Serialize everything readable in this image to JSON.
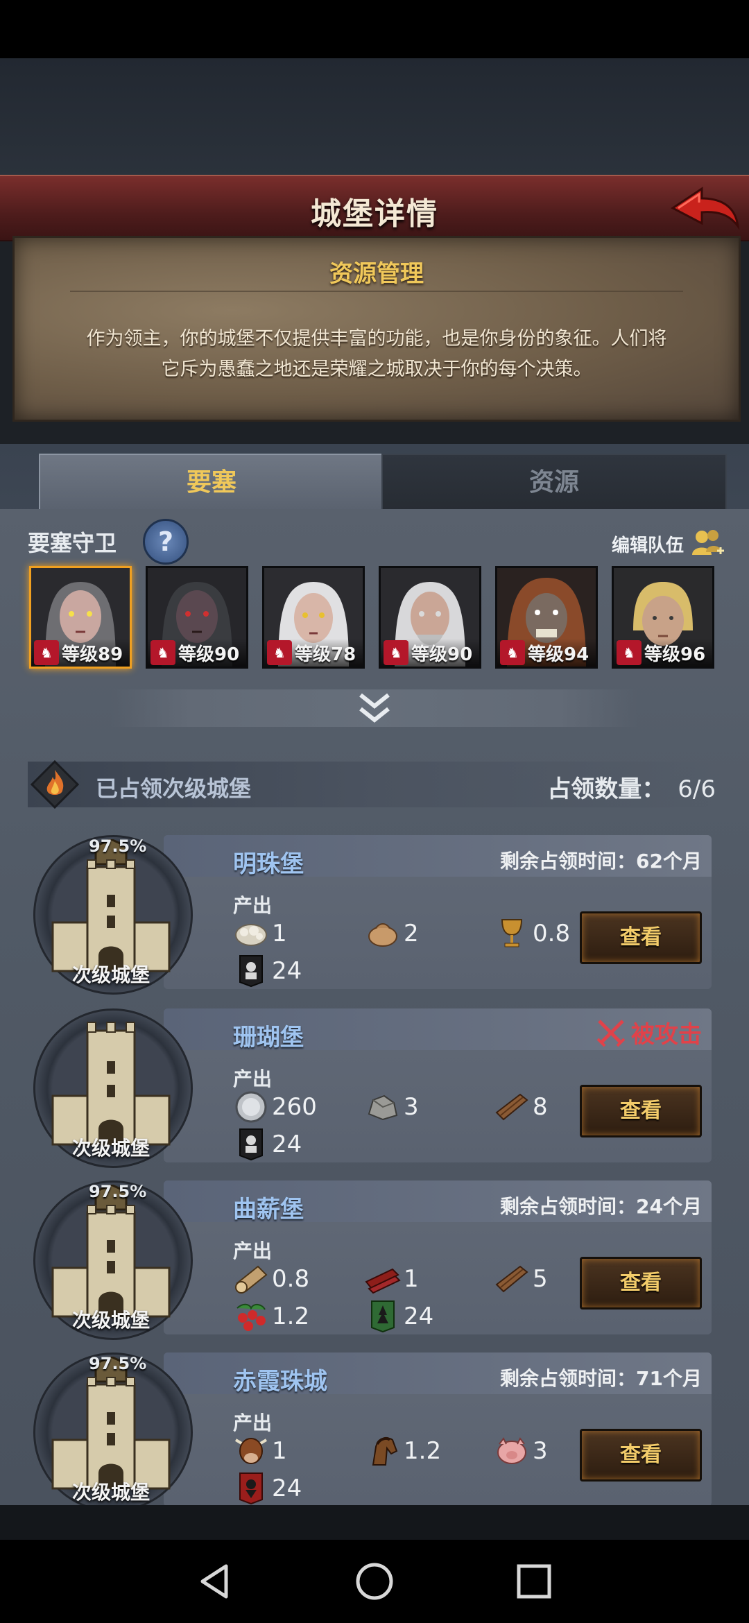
{
  "header": {
    "title": "城堡详情",
    "back_icon": "back-arrow-icon"
  },
  "info": {
    "title": "资源管理",
    "description_line1": "作为领主，你的城堡不仅提供丰富的功能，也是你身份的象征。人们将",
    "description_line2": "它斥为愚蠢之地还是荣耀之城取决于你的每个决策。"
  },
  "tabs": [
    {
      "label": "要塞",
      "active": true
    },
    {
      "label": "资源",
      "active": false
    }
  ],
  "fortress": {
    "guards_label": "要塞守卫",
    "help_label": "?",
    "edit_team_label": "编辑队伍",
    "guards": [
      {
        "level": "等级89",
        "selected": true
      },
      {
        "level": "等级90"
      },
      {
        "level": "等级78"
      },
      {
        "level": "等级90"
      },
      {
        "level": "等级94"
      },
      {
        "level": "等级96"
      }
    ]
  },
  "occupied": {
    "title": "已占领次级城堡",
    "count_label": "占领数量：",
    "count_value": "6/6",
    "castles": [
      {
        "name": "明珠堡",
        "status_label": "剩余占领时间：",
        "status_value": "62个月",
        "percent": "97.5%",
        "type_label": "次级城堡",
        "output_label": "产出",
        "resources": [
          {
            "icon": "wool-icon",
            "value": "1"
          },
          {
            "icon": "flour-sack-icon",
            "value": "2"
          },
          {
            "icon": "goblet-icon",
            "value": "0.8"
          },
          {
            "icon": "soldier-banner-icon",
            "value": "24"
          }
        ],
        "view_label": "查看"
      },
      {
        "name": "珊瑚堡",
        "attacked_label": "被攻击",
        "type_label": "次级城堡",
        "output_label": "产出",
        "resources": [
          {
            "icon": "silver-coin-icon",
            "value": "260"
          },
          {
            "icon": "stone-icon",
            "value": "3"
          },
          {
            "icon": "plank-icon",
            "value": "8"
          },
          {
            "icon": "soldier-banner-icon",
            "value": "24"
          }
        ],
        "view_label": "查看"
      },
      {
        "name": "曲薪堡",
        "status_label": "剩余占领时间：",
        "status_value": "24个月",
        "percent": "97.5%",
        "type_label": "次级城堡",
        "output_label": "产出",
        "resources": [
          {
            "icon": "log-icon",
            "value": "0.8"
          },
          {
            "icon": "red-wood-icon",
            "value": "1"
          },
          {
            "icon": "plank-icon",
            "value": "5"
          },
          {
            "icon": "berries-icon",
            "value": "1.2"
          },
          {
            "icon": "green-banner-icon",
            "value": "24"
          }
        ],
        "view_label": "查看"
      },
      {
        "name": "赤霞珠城",
        "status_label": "剩余占领时间：",
        "status_value": "71个月",
        "percent": "97.5%",
        "type_label": "次级城堡",
        "output_label": "产出",
        "resources": [
          {
            "icon": "cow-icon",
            "value": "1"
          },
          {
            "icon": "horse-icon",
            "value": "1.2"
          },
          {
            "icon": "pig-icon",
            "value": "3"
          },
          {
            "icon": "red-banner-icon",
            "value": "24"
          }
        ],
        "view_label": "查看"
      }
    ]
  },
  "navbar": {
    "back": "nav-back-icon",
    "home": "nav-home-icon",
    "recents": "nav-recents-icon"
  }
}
